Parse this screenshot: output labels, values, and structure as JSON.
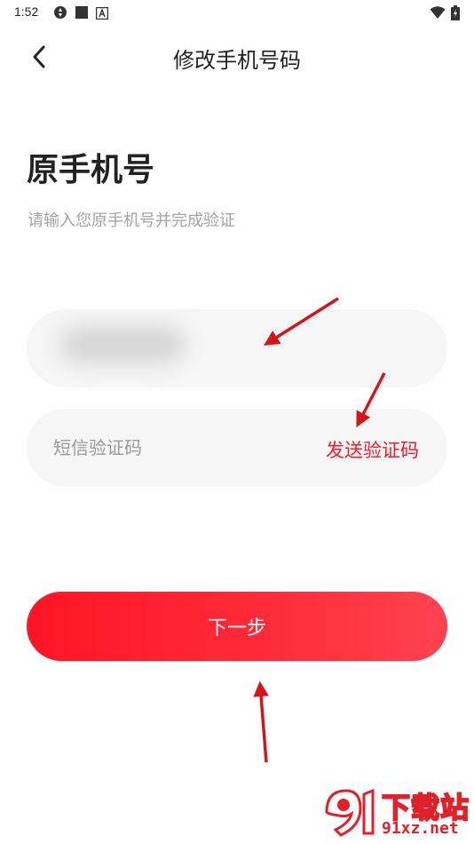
{
  "status_bar": {
    "time": "1:52",
    "icons": [
      "sync-icon",
      "square-icon",
      "a-icon",
      "wifi-icon",
      "battery-icon"
    ]
  },
  "nav": {
    "title": "修改手机号码",
    "back_icon": "chevron-left-icon"
  },
  "page": {
    "heading": "原手机号",
    "subtitle": "请输入您原手机号并完成验证"
  },
  "form": {
    "phone_value": "",
    "code_placeholder": "短信验证码",
    "code_value": "",
    "send_code_label": "发送验证码",
    "next_label": "下一步"
  },
  "watermark": {
    "brand": "下载站",
    "url": "91xz.net"
  },
  "colors": {
    "accent": "#f01a2b",
    "field_bg": "#f6f6f6",
    "annotation_arrow": "#d6141c"
  }
}
